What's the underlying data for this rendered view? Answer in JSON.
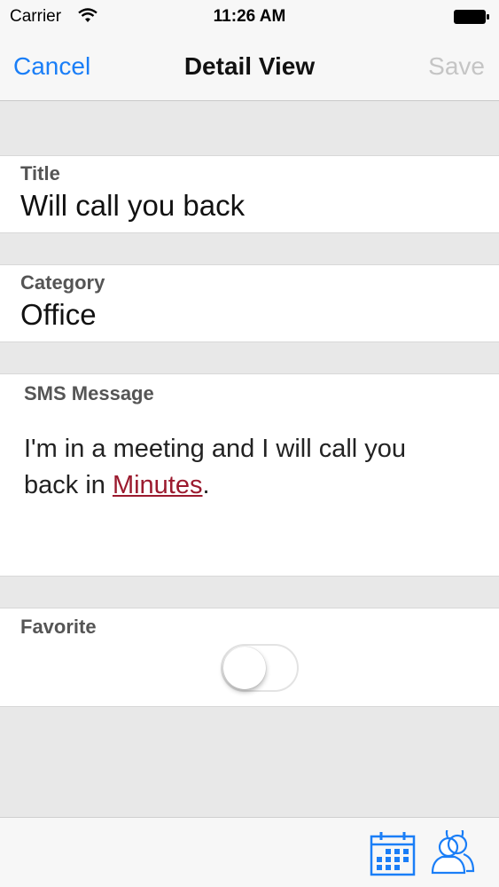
{
  "status_bar": {
    "carrier": "Carrier",
    "time": "11:26 AM",
    "wifi_icon": "wifi-icon",
    "battery_icon": "battery-icon"
  },
  "nav_bar": {
    "cancel_label": "Cancel",
    "title": "Detail View",
    "save_label": "Save"
  },
  "form": {
    "title_field": {
      "label": "Title",
      "value": "Will call you back"
    },
    "category_field": {
      "label": "Category",
      "value": "Office"
    },
    "sms_field": {
      "label": "SMS Message",
      "text_before": "I'm in a meeting and I will call you back in ",
      "link_text": "Minutes",
      "text_after": "."
    },
    "favorite_field": {
      "label": "Favorite",
      "toggle_on": false
    }
  },
  "tab_bar": {
    "items": [
      {
        "icon": "calendar-icon"
      },
      {
        "icon": "contacts-icon"
      }
    ]
  },
  "colors": {
    "accent": "#1a7ef7",
    "link": "#9b1a2e",
    "disabled": "#c5c5c5",
    "background": "#e8e8e8"
  }
}
